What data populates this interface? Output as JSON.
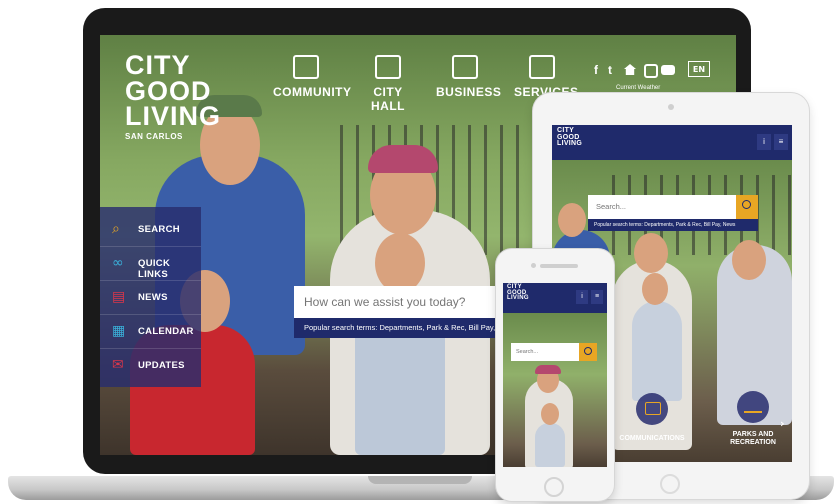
{
  "site": {
    "logo": {
      "line1": "CITY",
      "line2": "GOOD",
      "line3": "LIVING",
      "tagline": "SAN CARLOS"
    }
  },
  "laptop": {
    "nav": [
      {
        "label": "COMMUNITY",
        "icon": "house-icon"
      },
      {
        "label": "CITY HALL",
        "icon": "city-hall-icon"
      },
      {
        "label": "BUSINESS",
        "icon": "storefront-icon"
      },
      {
        "label": "SERVICES",
        "icon": "laptop-gear-icon"
      }
    ],
    "social": [
      "f",
      "t",
      "home",
      "ig",
      "yt"
    ],
    "lang": "EN",
    "weather_label": "Current Weather",
    "quick_menu": [
      {
        "label": "SEARCH",
        "icon": "search-icon"
      },
      {
        "label": "QUICK LINKS",
        "icon": "link-icon"
      },
      {
        "label": "NEWS",
        "icon": "newspaper-icon"
      },
      {
        "label": "CALENDAR",
        "icon": "calendar-icon"
      },
      {
        "label": "UPDATES",
        "icon": "mail-icon"
      }
    ],
    "search": {
      "placeholder": "How can we assist you today?",
      "popular": "Popular search terms: Departments, Park & Rec, Bill Pay, News"
    }
  },
  "tablet": {
    "search_placeholder": "Search...",
    "popular": "Popular search terms: Departments, Park & Rec, Bill Pay, News",
    "tiles": [
      {
        "label": "COMMUNICATIONS",
        "icon": "chat-icon"
      },
      {
        "label": "PARKS AND RECREATION",
        "icon": "bicycle-icon"
      }
    ],
    "header_buttons": [
      "i",
      "≡"
    ]
  },
  "phone": {
    "search_placeholder": "Search...",
    "header_buttons": [
      "i",
      "≡"
    ]
  },
  "colors": {
    "navy": "#1f2a6b",
    "accent": "#e8a624",
    "overlay": "#282d6e"
  }
}
